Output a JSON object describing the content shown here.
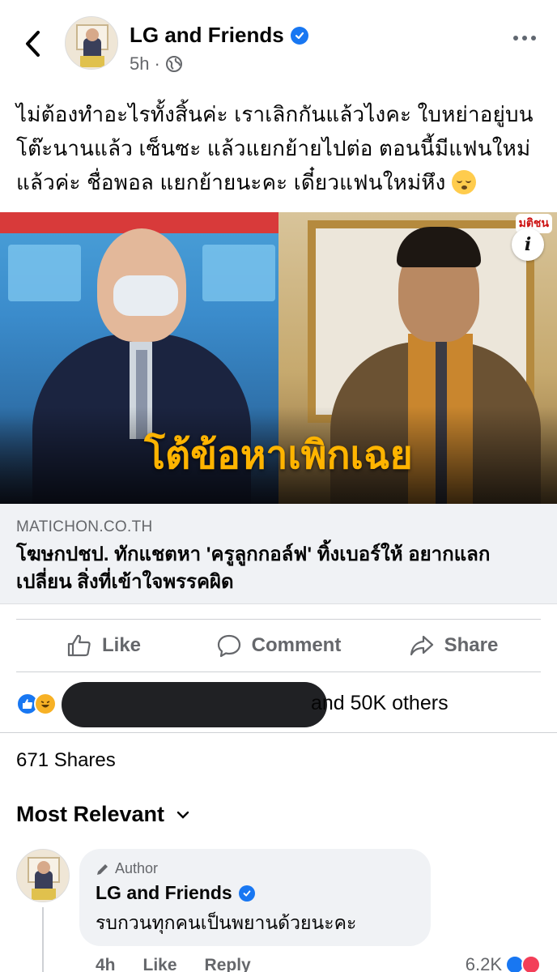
{
  "header": {
    "page_name": "LG and Friends",
    "time": "5h",
    "separator": "·",
    "icons": [
      "back-arrow-icon",
      "verified-badge-icon",
      "globe-icon",
      "more-options-icon"
    ]
  },
  "post": {
    "text": "ไม่ต้องทำอะไรทั้งสิ้นค่ะ เราเลิกกันแล้วไงคะ ใบหย่าอยู่บนโต๊ะนานแล้ว เซ็นซะ แล้วแยกย้ายไปต่อ ตอนนี้มีแฟนใหม่แล้วค่ะ ชื่อพอล แยกย้ายนะคะ เดี๋ยวแฟนใหม่หึง",
    "emoji": "kissing-face-icon"
  },
  "link": {
    "image_overlay_text": "โต้ข้อหาเพิกเฉย",
    "brand_logo": "มติชน",
    "info_label": "i",
    "domain": "MATICHON.CO.TH",
    "title": "โฆษกปชป. ทักแชตหา 'ครูลูกกอล์ฟ' ทิ้งเบอร์ให้ อยากแลกเปลี่ยน สิ่งที่เข้าใจพรรคผิด"
  },
  "actions": {
    "like": "Like",
    "comment": "Comment",
    "share": "Share"
  },
  "reactions": {
    "others_text": "and 50K others",
    "shares_text": "671 Shares"
  },
  "comments": {
    "sort_label": "Most Relevant",
    "items": [
      {
        "badge": "Author",
        "name": "LG and Friends",
        "text": "รบกวนทุกคนเป็นพยานด้วยนะคะ",
        "time": "4h",
        "like_label": "Like",
        "reply_label": "Reply",
        "reaction_count": "6.2K"
      }
    ]
  },
  "colors": {
    "facebook_blue": "#1877f2",
    "secondary_text": "#65676b",
    "caption_bg": "#f0f2f5",
    "overlay_yellow": "#ffb400"
  }
}
